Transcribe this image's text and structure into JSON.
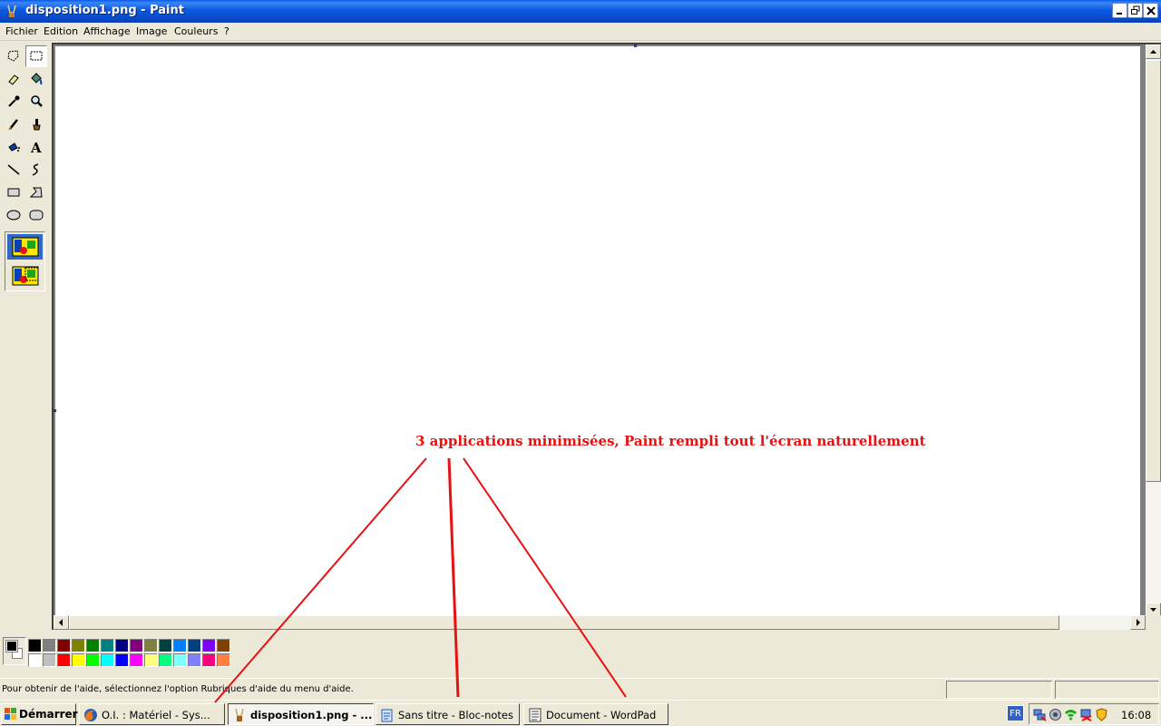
{
  "window": {
    "title": "disposition1.png - Paint",
    "controls": {
      "minimize": "minimize",
      "restore": "restore",
      "close": "close"
    }
  },
  "menu": {
    "items": [
      "Fichier",
      "Edition",
      "Affichage",
      "Image",
      "Couleurs",
      "?"
    ]
  },
  "toolbox": {
    "tools": [
      "free-form-select",
      "rect-select",
      "eraser",
      "fill",
      "color-picker",
      "magnifier",
      "pencil",
      "brush",
      "airbrush",
      "text",
      "line",
      "curve",
      "rectangle",
      "polygon",
      "ellipse",
      "rounded-rectangle"
    ],
    "selected_tool": "rect-select",
    "options_selected": "opaque"
  },
  "palette": {
    "foreground": "#000000",
    "background": "#FFFFFF",
    "row1": [
      "#000000",
      "#808080",
      "#800000",
      "#808000",
      "#008000",
      "#008080",
      "#000080",
      "#800080",
      "#808040",
      "#004040",
      "#0080FF",
      "#004080",
      "#8000FF",
      "#804000"
    ],
    "row2": [
      "#FFFFFF",
      "#C0C0C0",
      "#FF0000",
      "#FFFF00",
      "#00FF00",
      "#00FFFF",
      "#0000FF",
      "#FF00FF",
      "#FFFF80",
      "#00FF80",
      "#80FFFF",
      "#8080FF",
      "#FF0080",
      "#FF8040"
    ]
  },
  "status": {
    "help": "Pour obtenir de l'aide, sélectionnez l'option Rubriques d'aide du menu d'aide."
  },
  "annotation": {
    "text": "3 applications minimisées, Paint rempli tout l'écran naturellement",
    "color": "#E81010"
  },
  "taskbar": {
    "start_label": "Démarrer",
    "buttons": [
      {
        "label": "O.I. : Matériel - Sys...",
        "icon": "firefox-icon",
        "active": false
      },
      {
        "label": "disposition1.png - ...",
        "icon": "paint-icon",
        "active": true
      },
      {
        "label": "Sans titre - Bloc-notes",
        "icon": "notepad-icon",
        "active": false
      },
      {
        "label": "Document - WordPad",
        "icon": "wordpad-icon",
        "active": false
      }
    ],
    "language": "FR",
    "clock": "16:08"
  }
}
